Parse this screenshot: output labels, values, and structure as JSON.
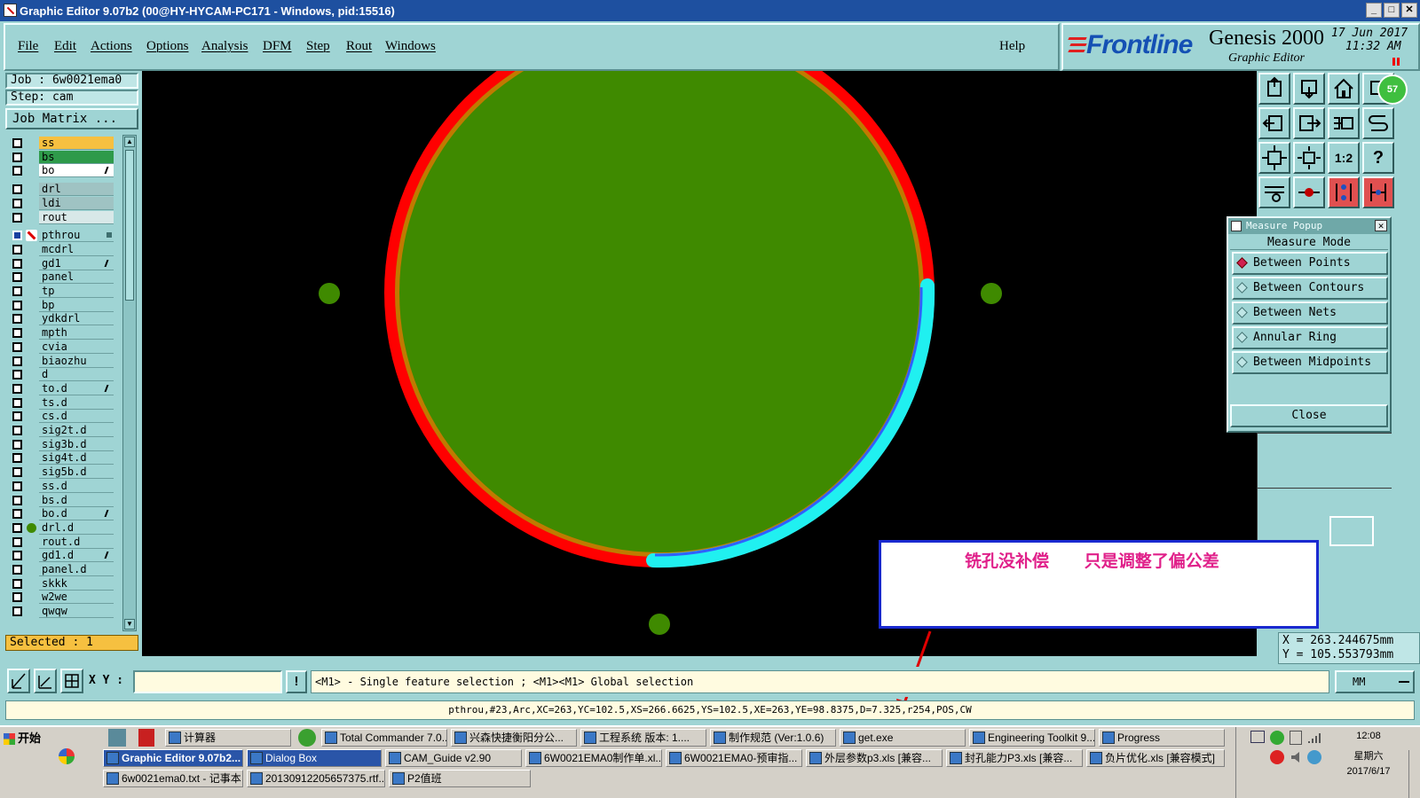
{
  "window": {
    "title": "Graphic Editor 9.07b2 (00@HY-HYCAM-PC171 - Windows, pid:15516)"
  },
  "menu": {
    "items": [
      "File",
      "Edit",
      "Actions",
      "Options",
      "Analysis",
      "DFM",
      "Step",
      "Rout",
      "Windows"
    ],
    "help": "Help"
  },
  "brand": {
    "logo": "Frontline",
    "product": "Genesis 2000",
    "subtitle": "Graphic Editor",
    "date": "17 Jun 2017",
    "time": "11:32 AM"
  },
  "job": {
    "job_label": "Job :  6w0021ema0",
    "step_label": "Step: cam",
    "matrix_button": "Job Matrix ..."
  },
  "layers": [
    {
      "name": "ss",
      "color": "#f6c040"
    },
    {
      "name": "bs",
      "color": "#2e9a4a"
    },
    {
      "name": "bo",
      "color": "#ffffff",
      "mark": true
    },
    {
      "name": "drl",
      "color": "#9fc3c3"
    },
    {
      "name": "ldi",
      "color": "#9fc3c3"
    },
    {
      "name": "rout",
      "color": "#d8e8e8"
    },
    {
      "name": "pthrou",
      "color": "#9fd4d4",
      "work": true
    },
    {
      "name": "mcdrl",
      "color": "#9fd4d4"
    },
    {
      "name": "gd1",
      "color": "#9fd4d4",
      "mark": true
    },
    {
      "name": "panel",
      "color": "#9fd4d4"
    },
    {
      "name": "tp",
      "color": "#9fd4d4"
    },
    {
      "name": "bp",
      "color": "#9fd4d4"
    },
    {
      "name": "ydkdrl",
      "color": "#9fd4d4"
    },
    {
      "name": "mpth",
      "color": "#9fd4d4"
    },
    {
      "name": "cvia",
      "color": "#9fd4d4"
    },
    {
      "name": "biaozhu",
      "color": "#9fd4d4"
    },
    {
      "name": "d",
      "color": "#9fd4d4"
    },
    {
      "name": "to.d",
      "color": "#9fd4d4",
      "mark": true
    },
    {
      "name": "ts.d",
      "color": "#9fd4d4"
    },
    {
      "name": "cs.d",
      "color": "#9fd4d4"
    },
    {
      "name": "sig2t.d",
      "color": "#9fd4d4"
    },
    {
      "name": "sig3b.d",
      "color": "#9fd4d4"
    },
    {
      "name": "sig4t.d",
      "color": "#9fd4d4"
    },
    {
      "name": "sig5b.d",
      "color": "#9fd4d4"
    },
    {
      "name": "ss.d",
      "color": "#9fd4d4"
    },
    {
      "name": "bs.d",
      "color": "#9fd4d4"
    },
    {
      "name": "bo.d",
      "color": "#9fd4d4",
      "mark": true
    },
    {
      "name": "drl.d",
      "color": "#9fd4d4",
      "dot": true
    },
    {
      "name": "rout.d",
      "color": "#9fd4d4"
    },
    {
      "name": "gd1.d",
      "color": "#9fd4d4",
      "mark": true
    },
    {
      "name": "panel.d",
      "color": "#9fd4d4"
    },
    {
      "name": "skkk",
      "color": "#9fd4d4"
    },
    {
      "name": "w2we",
      "color": "#9fd4d4"
    },
    {
      "name": "qwqw",
      "color": "#9fd4d4"
    }
  ],
  "selected": "Selected : 1",
  "measure": {
    "title": "Measure Popup",
    "mode_label": "Measure Mode",
    "options": [
      "Between Points",
      "Between Contours",
      "Between Nets",
      "Annular Ring",
      "Between Midpoints"
    ],
    "close": "Close"
  },
  "badge": "57",
  "annotation": {
    "text": "铣孔没补偿      只是调整了偏公差"
  },
  "coords": {
    "x": "X  =  263.244675mm",
    "y": "Y  =  105.553793mm"
  },
  "command": {
    "xy_label": "X Y :",
    "input_value": "",
    "hint": "<M1> - Single feature selection ; <M1><M1> Global selection",
    "units": "MM"
  },
  "feature_info": "pthrou,#23,Arc,XC=263,YC=102.5,XS=266.6625,YS=102.5,XE=263,YE=98.8375,D=7.325,r254,POS,CW",
  "taskbar": {
    "start": "开始",
    "row1": [
      "计算器",
      "Total Commander 7.0...",
      "兴森快捷衡阳分公...",
      "工程系统  版本: 1....",
      "制作规范 (Ver:1.0.6)",
      "get.exe",
      "Engineering Toolkit 9....",
      "Progress"
    ],
    "row2": [
      "Graphic Editor 9.07b2...",
      "Dialog Box",
      "CAM_Guide v2.90",
      "6W0021EMA0制作单.xl...",
      "6W0021EMA0-预审指...",
      "外层参数p3.xls [兼容...",
      "封孔能力P3.xls [兼容...",
      "负片优化.xls [兼容模式]"
    ],
    "row3": [
      "6w0021ema0.txt - 记事本",
      "20130912205657375.rtf...",
      "P2值班"
    ],
    "clock_time": "12:08",
    "clock_day": "星期六",
    "clock_date": "2017/6/17"
  },
  "colors": {
    "pad": "#3f8a00",
    "outline": "#ff0000",
    "highlight": "#20f0f0",
    "annotation_text": "#e0208a"
  }
}
